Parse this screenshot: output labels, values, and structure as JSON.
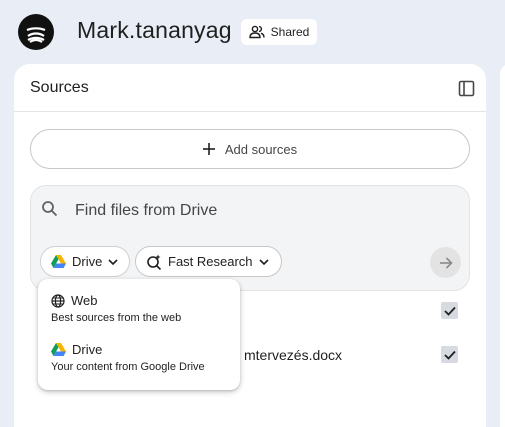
{
  "notebook": {
    "title": "Mark.tananyag",
    "shared_label": "Shared"
  },
  "panel": {
    "title": "Sources",
    "add_sources_label": "Add sources",
    "search_placeholder": "Find files from Drive",
    "source_chip": "Drive",
    "research_chip": "Fast Research"
  },
  "dropdown": {
    "items": [
      {
        "title": "Web",
        "subtitle": "Best sources from the web",
        "icon": "globe-icon"
      },
      {
        "title": "Drive",
        "subtitle": "Your content from Google Drive",
        "icon": "google-drive-icon"
      }
    ]
  },
  "sources": [
    {
      "name": "",
      "checked": true
    },
    {
      "name": "mtervezés.docx",
      "checked": true
    }
  ],
  "colors": {
    "background": "#e9edf6",
    "panel": "#ffffff",
    "drive_green": "#0f9d58",
    "drive_yellow": "#f4b400",
    "drive_blue": "#4285f4"
  }
}
